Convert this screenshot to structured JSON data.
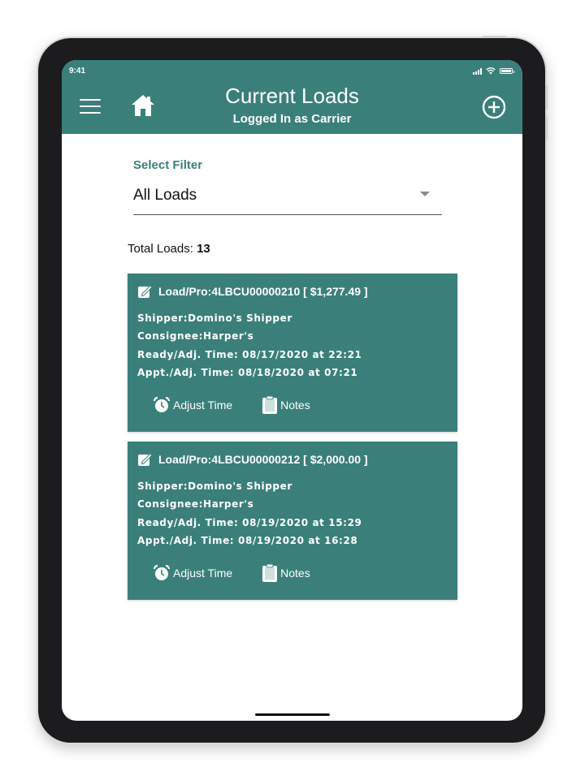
{
  "status_bar": {
    "time": "9:41"
  },
  "header": {
    "title": "Current Loads",
    "subtitle": "Logged In as Carrier"
  },
  "filter": {
    "label": "Select Filter",
    "selected": "All Loads"
  },
  "summary": {
    "total_label": "Total Loads:",
    "total_count": "13"
  },
  "loads": [
    {
      "title": "Load/Pro:4LBCU00000210 [ $1,277.49 ]",
      "shipper": "Shipper:Domino's Shipper",
      "consignee": "Consignee:Harper's",
      "ready": "Ready/Adj. Time: 08/17/2020 at 22:21",
      "appt": "Appt./Adj. Time: 08/18/2020 at 07:21",
      "adjust_label": "Adjust Time",
      "notes_label": "Notes"
    },
    {
      "title": "Load/Pro:4LBCU00000212 [ $2,000.00 ]",
      "shipper": "Shipper:Domino's Shipper",
      "consignee": "Consignee:Harper's",
      "ready": "Ready/Adj. Time: 08/19/2020 at 15:29",
      "appt": "Appt./Adj. Time: 08/19/2020 at 16:28",
      "adjust_label": "Adjust Time",
      "notes_label": "Notes"
    }
  ],
  "icons": {
    "menu": "hamburger-menu-icon",
    "home": "home-icon",
    "add": "add-circle-icon",
    "edit": "edit-icon",
    "alarm": "alarm-clock-icon",
    "notes": "clipboard-icon"
  },
  "colors": {
    "accent": "#3a7f7a",
    "text": "#111111",
    "background": "#ffffff"
  }
}
